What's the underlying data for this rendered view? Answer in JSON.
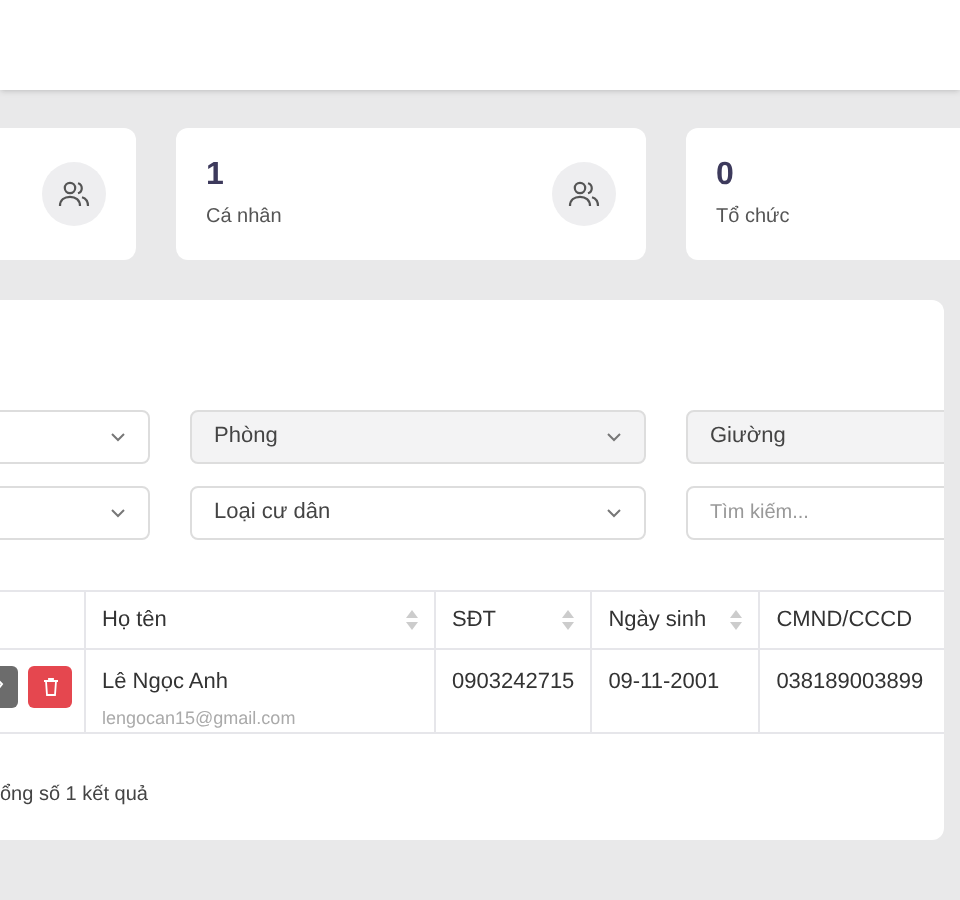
{
  "stats": [
    {
      "value": "1",
      "label": "Cá nhân"
    },
    {
      "value": "0",
      "label": "Tổ chức"
    }
  ],
  "filters": [
    {
      "kind": "select",
      "disabled": false
    },
    {
      "kind": "select",
      "value": "Phòng",
      "disabled": true
    },
    {
      "kind": "select",
      "value": "Giường",
      "disabled": true
    },
    {
      "kind": "select",
      "disabled": false
    },
    {
      "kind": "select",
      "value": "Loại cư dân",
      "disabled": false
    },
    {
      "kind": "search",
      "placeholder": "Tìm kiếm..."
    }
  ],
  "table": {
    "columns": [
      "Họ tên",
      "SĐT",
      "Ngày sinh",
      "CMND/CCCD"
    ],
    "rows": [
      {
        "name": "Lê Ngọc Anh",
        "email": "lengocan15@gmail.com",
        "phone": "0903242715",
        "birthday": "09-11-2001",
        "id_number": "038189003899"
      }
    ]
  },
  "summary": "ổng số 1 kết quả"
}
